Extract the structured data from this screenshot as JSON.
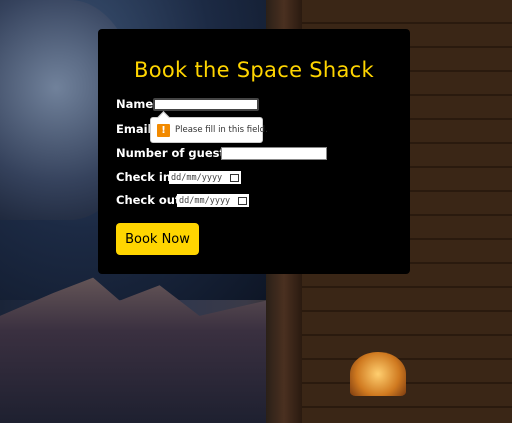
{
  "form": {
    "title": "Book the Space Shack",
    "name_label": "Name:",
    "email_label": "Email:",
    "guests_label": "Number of guests:",
    "checkin_label": "Check in:",
    "checkout_label": "Check out:",
    "checkin_placeholder": "dd/mm/yyyy",
    "checkout_placeholder": "dd/mm/yyyy",
    "submit_label": "Book Now"
  },
  "validation_tooltip": {
    "icon": "warning-icon",
    "text": "Please fill in this field.",
    "icon_color": "#f28a00"
  },
  "colors": {
    "accent": "#ffd500",
    "card": "#000000"
  }
}
